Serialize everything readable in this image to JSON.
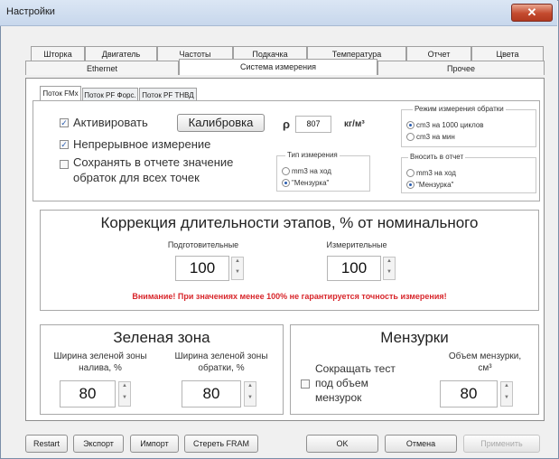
{
  "window": {
    "title": "Настройки",
    "close_glyph": "✕"
  },
  "tabs": {
    "row1": [
      "Шторка",
      "Двигатель",
      "Частоты",
      "Подкачка",
      "Температура",
      "Отчет",
      "Цвета"
    ],
    "row2": [
      "Ethernet",
      "Система измерения",
      "Прочее"
    ],
    "active": "Система измерения"
  },
  "subtabs": {
    "items": [
      "Поток FMx",
      "Поток PF Форс.",
      "Поток PF ТНВД"
    ],
    "active": "Поток FMx"
  },
  "flow": {
    "activate_label": "Активировать",
    "activate_checked": true,
    "calibrate_label": "Калибровка",
    "rho_symbol": "ρ",
    "density_value": "807",
    "density_unit": "кг/м³",
    "continuous_label": "Непрерывное измерение",
    "continuous_checked": true,
    "save_label_line1": "Сохранять в отчете значение",
    "save_label_line2": "обраток для всех точек",
    "save_checked": false,
    "meas_type": {
      "title": "Тип измерения",
      "opt1": "mm3 на ход",
      "opt2": "\"Мензурка\"",
      "selected": 2
    },
    "return_mode": {
      "title": "Режим измерения обратки",
      "opt1": "cm3 на 1000 циклов",
      "opt2": "cm3 на мин",
      "selected": 1
    },
    "report": {
      "title": "Вносить в отчет",
      "opt1": "mm3 на ход",
      "opt2": "\"Мензурка\"",
      "selected": 2
    }
  },
  "correction": {
    "title": "Коррекция длительности этапов, %  от номинального",
    "prep_label": "Подготовительные",
    "prep_value": "100",
    "meas_label": "Измерительные",
    "meas_value": "100",
    "warning": "Внимание! При значениях менее 100% не гарантируется точность измерения!"
  },
  "green_zone": {
    "title": "Зеленая зона",
    "fill_label_line1": "Ширина зеленой зоны",
    "fill_label_line2": "налива, %",
    "fill_value": "80",
    "return_label_line1": "Ширина зеленой зоны",
    "return_label_line2": "обратки, %",
    "return_value": "80"
  },
  "beakers": {
    "title": "Мензурки",
    "reduce_line1": "Сокращать тест",
    "reduce_line2": "под объем",
    "reduce_line3": "мензурок",
    "reduce_checked": false,
    "volume_label_line1": "Объем мензурки,",
    "volume_label_line2": "см³",
    "volume_value": "80"
  },
  "buttons": {
    "restart": "Restart",
    "export": "Экспорт",
    "import": "Импорт",
    "erase": "Стереть FRAM",
    "ok": "OK",
    "cancel": "Отмена",
    "apply": "Применить"
  },
  "spinner_glyphs": {
    "up": "▲",
    "down": "▼",
    "check": "✓"
  }
}
